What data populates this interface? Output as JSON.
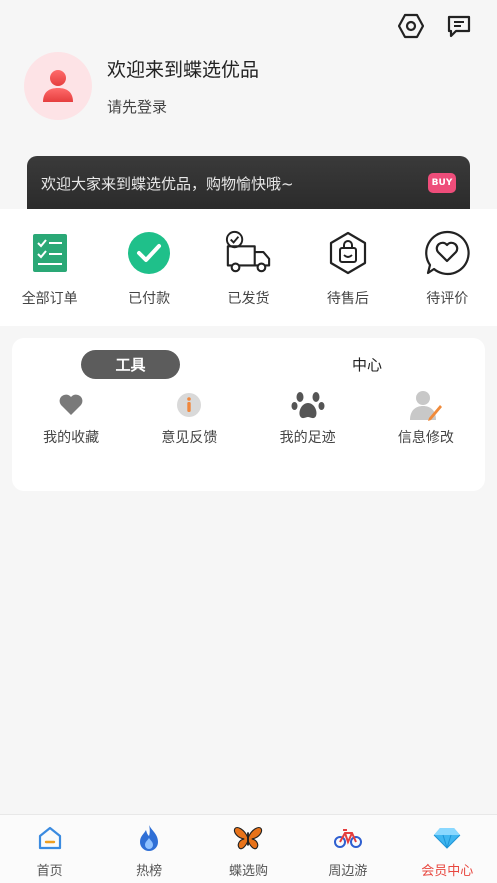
{
  "header": {
    "icons": [
      "settings-hex-icon",
      "message-icon"
    ]
  },
  "profile": {
    "welcome": "欢迎来到蝶选优品",
    "login_prompt": "请先登录"
  },
  "banner": {
    "text": "欢迎大家来到蝶选优品，购物愉快哦~",
    "badge": "BUY"
  },
  "orders": [
    {
      "label": "全部订单",
      "icon": "checklist-icon"
    },
    {
      "label": "已付款",
      "icon": "check-circle-icon"
    },
    {
      "label": "已发货",
      "icon": "delivery-truck-icon"
    },
    {
      "label": "待售后",
      "icon": "after-sale-bag-icon"
    },
    {
      "label": "待评价",
      "icon": "heart-chat-icon"
    }
  ],
  "tools": {
    "tabs": [
      {
        "label": "工具",
        "active": true
      },
      {
        "label": "中心",
        "active": false
      }
    ],
    "items": [
      {
        "label": "我的收藏",
        "icon": "heart-icon"
      },
      {
        "label": "意见反馈",
        "icon": "info-icon"
      },
      {
        "label": "我的足迹",
        "icon": "paw-icon"
      },
      {
        "label": "信息修改",
        "icon": "user-edit-icon"
      }
    ]
  },
  "tabbar": [
    {
      "label": "首页",
      "icon": "home-icon",
      "active": false
    },
    {
      "label": "热榜",
      "icon": "flame-icon",
      "active": false
    },
    {
      "label": "蝶选购",
      "icon": "butterfly-icon",
      "active": false
    },
    {
      "label": "周边游",
      "icon": "bicycle-icon",
      "active": false
    },
    {
      "label": "会员中心",
      "icon": "diamond-icon",
      "active": true
    }
  ],
  "colors": {
    "accent": "#e8473f",
    "paid_green": "#1fc08a",
    "list_green": "#2aa876"
  }
}
